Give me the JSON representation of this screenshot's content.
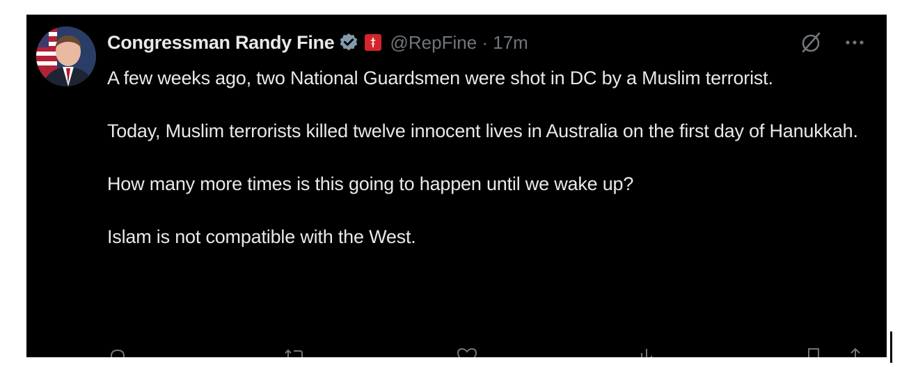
{
  "tweet": {
    "author": {
      "display_name": "Congressman Randy Fine",
      "handle_time": "@RepFine · 17m"
    },
    "paragraphs": [
      "A few weeks ago, two National Guardsmen were shot in DC by a Muslim terrorist.",
      "Today, Muslim terrorists killed twelve innocent lives in Australia on the first day of Hanukkah.",
      "How many more times is this going to happen until we wake up?",
      "Islam is not compatible with the West."
    ]
  },
  "icons": {
    "verified": "verified-badge-icon",
    "flag": "government-flag-icon",
    "grok": "grok-icon",
    "more": "more-icon",
    "reply": "reply-icon",
    "retweet": "retweet-icon",
    "like": "like-icon",
    "views": "views-icon",
    "bookmark": "bookmark-icon",
    "share": "share-icon"
  },
  "colors": {
    "background": "#000000",
    "text": "#e7e9ea",
    "secondary_text": "#71767b",
    "verified": "#829aab",
    "flag_badge": "#d4242c"
  }
}
